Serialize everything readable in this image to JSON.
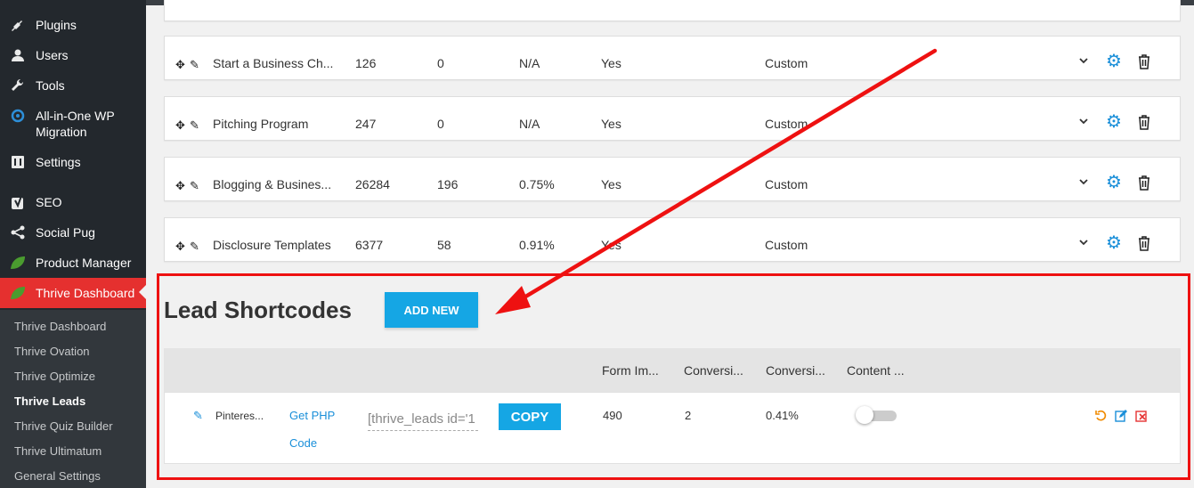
{
  "sidebar": {
    "items": [
      {
        "label": "Plugins",
        "icon": "plug-icon"
      },
      {
        "label": "Users",
        "icon": "user-icon"
      },
      {
        "label": "Tools",
        "icon": "wrench-icon"
      },
      {
        "label": "All-in-One WP Migration",
        "icon": "migration-icon"
      },
      {
        "label": "Settings",
        "icon": "settings-icon"
      },
      {
        "label": "SEO",
        "icon": "yoast-icon"
      },
      {
        "label": "Social Pug",
        "icon": "share-icon"
      },
      {
        "label": "Product Manager",
        "icon": "leaf-icon"
      },
      {
        "label": "Thrive Dashboard",
        "icon": "leaf-icon"
      }
    ],
    "submenu": [
      "Thrive Dashboard",
      "Thrive Ovation",
      "Thrive Optimize",
      "Thrive Leads",
      "Thrive Quiz Builder",
      "Thrive Ultimatum",
      "General Settings"
    ],
    "active_color": "#e5302f"
  },
  "forms": [
    {
      "name": "Start a Business Ch...",
      "impressions": "126",
      "conversions": "0",
      "rate": "N/A",
      "ab": "Yes",
      "type": "Custom"
    },
    {
      "name": "Pitching Program",
      "impressions": "247",
      "conversions": "0",
      "rate": "N/A",
      "ab": "Yes",
      "type": "Custom"
    },
    {
      "name": "Blogging & Busines...",
      "impressions": "26284",
      "conversions": "196",
      "rate": "0.75%",
      "ab": "Yes",
      "type": "Custom"
    },
    {
      "name": "Disclosure Templates",
      "impressions": "6377",
      "conversions": "58",
      "rate": "0.91%",
      "ab": "Yes",
      "type": "Custom"
    }
  ],
  "lead_shortcodes": {
    "title": "Lead Shortcodes",
    "add_new_label": "ADD NEW",
    "headers": [
      "Form Im...",
      "Conversi...",
      "Conversi...",
      "Content ..."
    ],
    "row": {
      "name": "Pinteres...",
      "php_link_line1": "Get PHP",
      "php_link_line2": "Code",
      "shortcode_value": "[thrive_leads id='1",
      "copy_label": "COPY",
      "impressions": "490",
      "conversions": "2",
      "rate": "0.41%",
      "content_locking": false
    }
  },
  "colors": {
    "accent_blue": "#15a6e4",
    "highlight_red": "#ee1111"
  }
}
